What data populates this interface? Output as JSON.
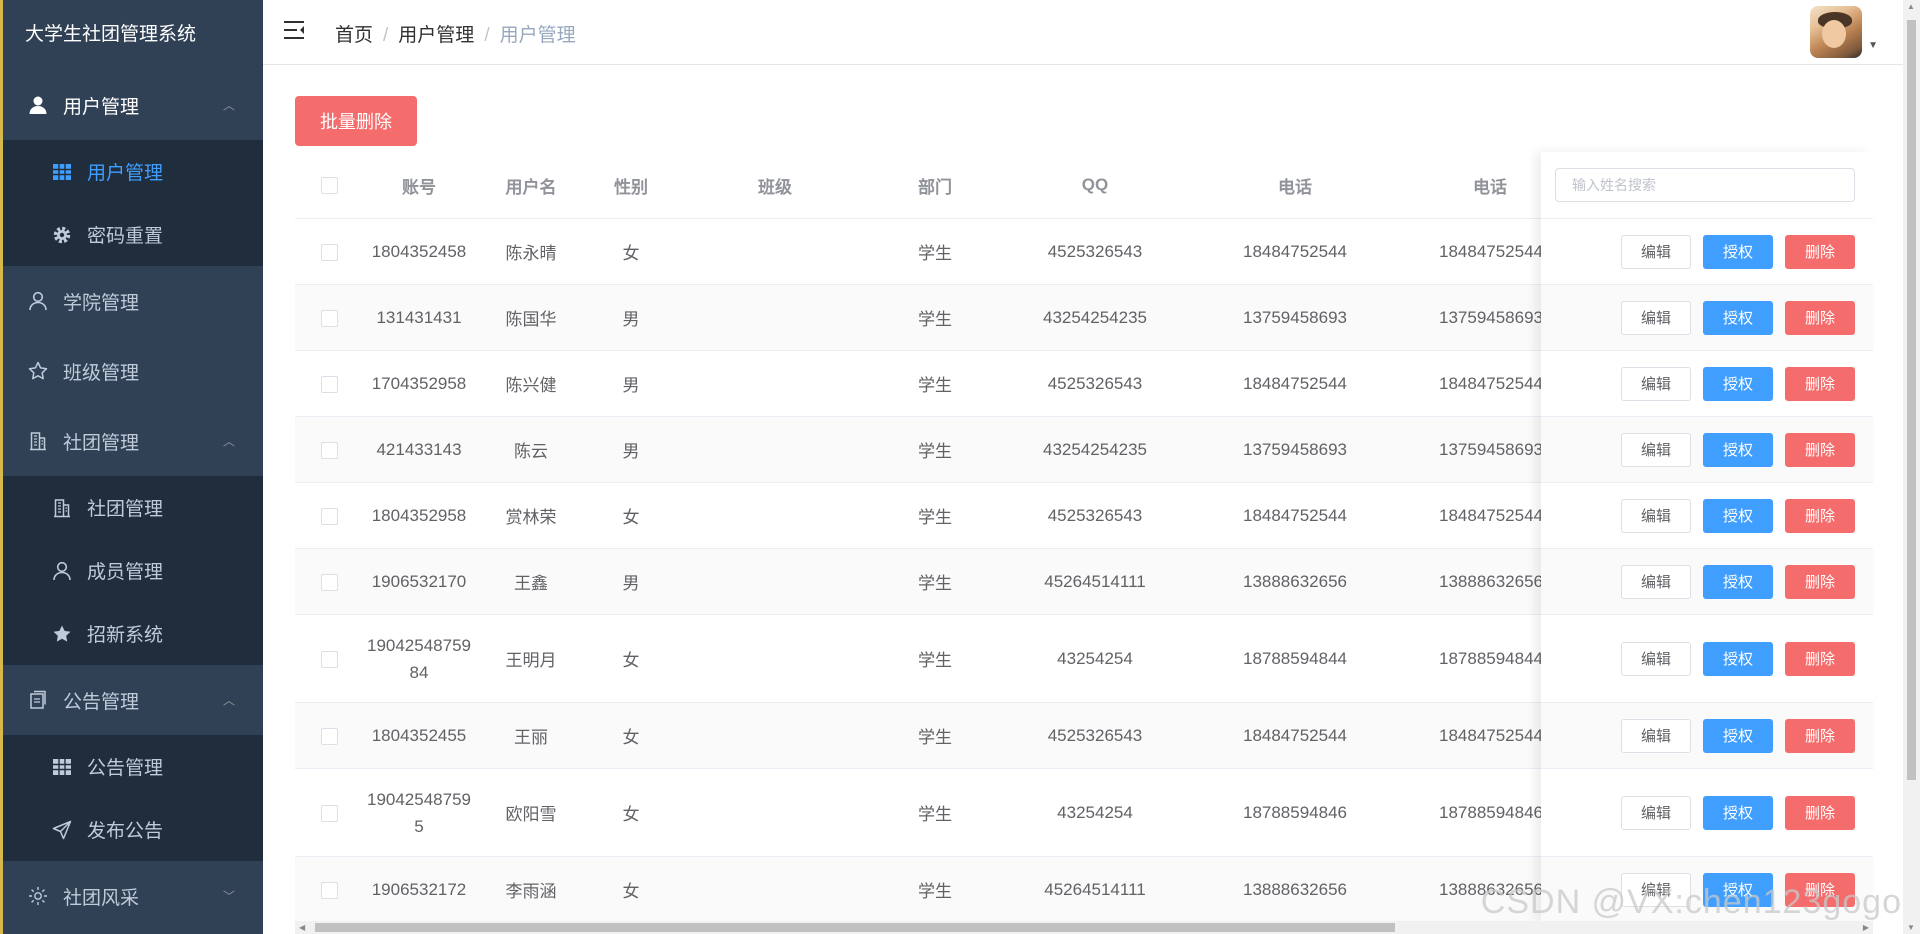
{
  "sidebar": {
    "title": "大学生社团管理系统",
    "menus": [
      {
        "label": "用户管理",
        "icon": "user-icon",
        "expanded": true,
        "children": [
          {
            "label": "用户管理",
            "icon": "grid-icon",
            "active": true
          },
          {
            "label": "密码重置",
            "icon": "gear-icon"
          }
        ]
      },
      {
        "label": "学院管理",
        "icon": "user-outline-icon"
      },
      {
        "label": "班级管理",
        "icon": "star-outline-icon"
      },
      {
        "label": "社团管理",
        "icon": "building-icon",
        "expanded": true,
        "children": [
          {
            "label": "社团管理",
            "icon": "building-icon"
          },
          {
            "label": "成员管理",
            "icon": "user-outline-icon"
          },
          {
            "label": "招新系统",
            "icon": "star-filled-icon"
          }
        ]
      },
      {
        "label": "公告管理",
        "icon": "document-icon",
        "expanded": true,
        "children": [
          {
            "label": "公告管理",
            "icon": "grid-icon"
          },
          {
            "label": "发布公告",
            "icon": "send-icon"
          }
        ]
      },
      {
        "label": "社团风采",
        "icon": "sun-icon"
      }
    ]
  },
  "header": {
    "breadcrumb": [
      "首页",
      "用户管理",
      "用户管理"
    ],
    "breadcrumb_sep": "/"
  },
  "toolbar": {
    "batch_delete": "批量删除"
  },
  "search": {
    "placeholder": "输入姓名搜索"
  },
  "table": {
    "columns": [
      "账号",
      "用户名",
      "性别",
      "班级",
      "部门",
      "QQ",
      "电话",
      "电话"
    ],
    "rows": [
      [
        "1804352458",
        "陈永晴",
        "女",
        "",
        "学生",
        "4525326543",
        "18484752544",
        "18484752544"
      ],
      [
        "131431431",
        "陈国华",
        "男",
        "",
        "学生",
        "43254254235",
        "13759458693",
        "13759458693"
      ],
      [
        "1704352958",
        "陈兴健",
        "男",
        "",
        "学生",
        "4525326543",
        "18484752544",
        "18484752544"
      ],
      [
        "421433143",
        "陈云",
        "男",
        "",
        "学生",
        "43254254235",
        "13759458693",
        "13759458693"
      ],
      [
        "1804352958",
        "赏林荣",
        "女",
        "",
        "学生",
        "4525326543",
        "18484752544",
        "18484752544"
      ],
      [
        "1906532170",
        "王鑫",
        "男",
        "",
        "学生",
        "45264514111",
        "13888632656",
        "13888632656"
      ],
      [
        "1904254875984",
        "王明月",
        "女",
        "",
        "学生",
        "43254254",
        "18788594844",
        "18788594844"
      ],
      [
        "1804352455",
        "王丽",
        "女",
        "",
        "学生",
        "4525326543",
        "18484752544",
        "18484752544"
      ],
      [
        "190425487595",
        "欧阳雪",
        "女",
        "",
        "学生",
        "43254254",
        "18788594846",
        "18788594846"
      ],
      [
        "1906532172",
        "李雨涵",
        "女",
        "",
        "学生",
        "45264514111",
        "13888632656",
        "13888632656"
      ]
    ]
  },
  "actions": {
    "edit": "编辑",
    "authorize": "授权",
    "delete": "删除"
  },
  "watermark": "CSDN @VX:chen123gogo",
  "colors": {
    "sidebar_bg": "#304156",
    "submenu_bg": "#1f2d3d",
    "primary": "#409eff",
    "danger": "#f56c6c"
  }
}
